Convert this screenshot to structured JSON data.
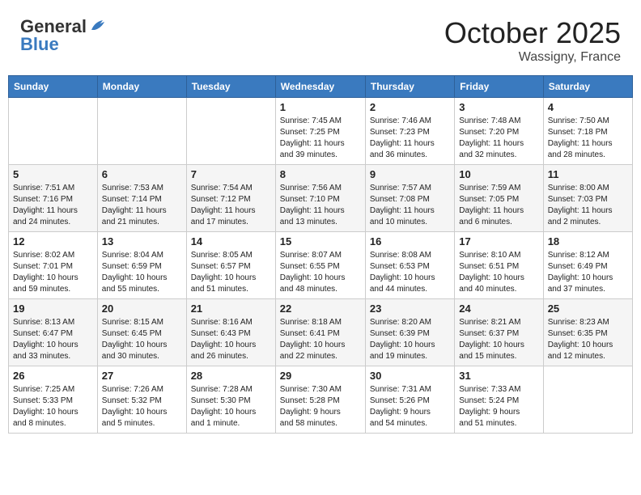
{
  "header": {
    "logo_general": "General",
    "logo_blue": "Blue",
    "month": "October 2025",
    "location": "Wassigny, France"
  },
  "weekdays": [
    "Sunday",
    "Monday",
    "Tuesday",
    "Wednesday",
    "Thursday",
    "Friday",
    "Saturday"
  ],
  "weeks": [
    [
      {
        "day": "",
        "info": ""
      },
      {
        "day": "",
        "info": ""
      },
      {
        "day": "",
        "info": ""
      },
      {
        "day": "1",
        "info": "Sunrise: 7:45 AM\nSunset: 7:25 PM\nDaylight: 11 hours\nand 39 minutes."
      },
      {
        "day": "2",
        "info": "Sunrise: 7:46 AM\nSunset: 7:23 PM\nDaylight: 11 hours\nand 36 minutes."
      },
      {
        "day": "3",
        "info": "Sunrise: 7:48 AM\nSunset: 7:20 PM\nDaylight: 11 hours\nand 32 minutes."
      },
      {
        "day": "4",
        "info": "Sunrise: 7:50 AM\nSunset: 7:18 PM\nDaylight: 11 hours\nand 28 minutes."
      }
    ],
    [
      {
        "day": "5",
        "info": "Sunrise: 7:51 AM\nSunset: 7:16 PM\nDaylight: 11 hours\nand 24 minutes."
      },
      {
        "day": "6",
        "info": "Sunrise: 7:53 AM\nSunset: 7:14 PM\nDaylight: 11 hours\nand 21 minutes."
      },
      {
        "day": "7",
        "info": "Sunrise: 7:54 AM\nSunset: 7:12 PM\nDaylight: 11 hours\nand 17 minutes."
      },
      {
        "day": "8",
        "info": "Sunrise: 7:56 AM\nSunset: 7:10 PM\nDaylight: 11 hours\nand 13 minutes."
      },
      {
        "day": "9",
        "info": "Sunrise: 7:57 AM\nSunset: 7:08 PM\nDaylight: 11 hours\nand 10 minutes."
      },
      {
        "day": "10",
        "info": "Sunrise: 7:59 AM\nSunset: 7:05 PM\nDaylight: 11 hours\nand 6 minutes."
      },
      {
        "day": "11",
        "info": "Sunrise: 8:00 AM\nSunset: 7:03 PM\nDaylight: 11 hours\nand 2 minutes."
      }
    ],
    [
      {
        "day": "12",
        "info": "Sunrise: 8:02 AM\nSunset: 7:01 PM\nDaylight: 10 hours\nand 59 minutes."
      },
      {
        "day": "13",
        "info": "Sunrise: 8:04 AM\nSunset: 6:59 PM\nDaylight: 10 hours\nand 55 minutes."
      },
      {
        "day": "14",
        "info": "Sunrise: 8:05 AM\nSunset: 6:57 PM\nDaylight: 10 hours\nand 51 minutes."
      },
      {
        "day": "15",
        "info": "Sunrise: 8:07 AM\nSunset: 6:55 PM\nDaylight: 10 hours\nand 48 minutes."
      },
      {
        "day": "16",
        "info": "Sunrise: 8:08 AM\nSunset: 6:53 PM\nDaylight: 10 hours\nand 44 minutes."
      },
      {
        "day": "17",
        "info": "Sunrise: 8:10 AM\nSunset: 6:51 PM\nDaylight: 10 hours\nand 40 minutes."
      },
      {
        "day": "18",
        "info": "Sunrise: 8:12 AM\nSunset: 6:49 PM\nDaylight: 10 hours\nand 37 minutes."
      }
    ],
    [
      {
        "day": "19",
        "info": "Sunrise: 8:13 AM\nSunset: 6:47 PM\nDaylight: 10 hours\nand 33 minutes."
      },
      {
        "day": "20",
        "info": "Sunrise: 8:15 AM\nSunset: 6:45 PM\nDaylight: 10 hours\nand 30 minutes."
      },
      {
        "day": "21",
        "info": "Sunrise: 8:16 AM\nSunset: 6:43 PM\nDaylight: 10 hours\nand 26 minutes."
      },
      {
        "day": "22",
        "info": "Sunrise: 8:18 AM\nSunset: 6:41 PM\nDaylight: 10 hours\nand 22 minutes."
      },
      {
        "day": "23",
        "info": "Sunrise: 8:20 AM\nSunset: 6:39 PM\nDaylight: 10 hours\nand 19 minutes."
      },
      {
        "day": "24",
        "info": "Sunrise: 8:21 AM\nSunset: 6:37 PM\nDaylight: 10 hours\nand 15 minutes."
      },
      {
        "day": "25",
        "info": "Sunrise: 8:23 AM\nSunset: 6:35 PM\nDaylight: 10 hours\nand 12 minutes."
      }
    ],
    [
      {
        "day": "26",
        "info": "Sunrise: 7:25 AM\nSunset: 5:33 PM\nDaylight: 10 hours\nand 8 minutes."
      },
      {
        "day": "27",
        "info": "Sunrise: 7:26 AM\nSunset: 5:32 PM\nDaylight: 10 hours\nand 5 minutes."
      },
      {
        "day": "28",
        "info": "Sunrise: 7:28 AM\nSunset: 5:30 PM\nDaylight: 10 hours\nand 1 minute."
      },
      {
        "day": "29",
        "info": "Sunrise: 7:30 AM\nSunset: 5:28 PM\nDaylight: 9 hours\nand 58 minutes."
      },
      {
        "day": "30",
        "info": "Sunrise: 7:31 AM\nSunset: 5:26 PM\nDaylight: 9 hours\nand 54 minutes."
      },
      {
        "day": "31",
        "info": "Sunrise: 7:33 AM\nSunset: 5:24 PM\nDaylight: 9 hours\nand 51 minutes."
      },
      {
        "day": "",
        "info": ""
      }
    ]
  ]
}
